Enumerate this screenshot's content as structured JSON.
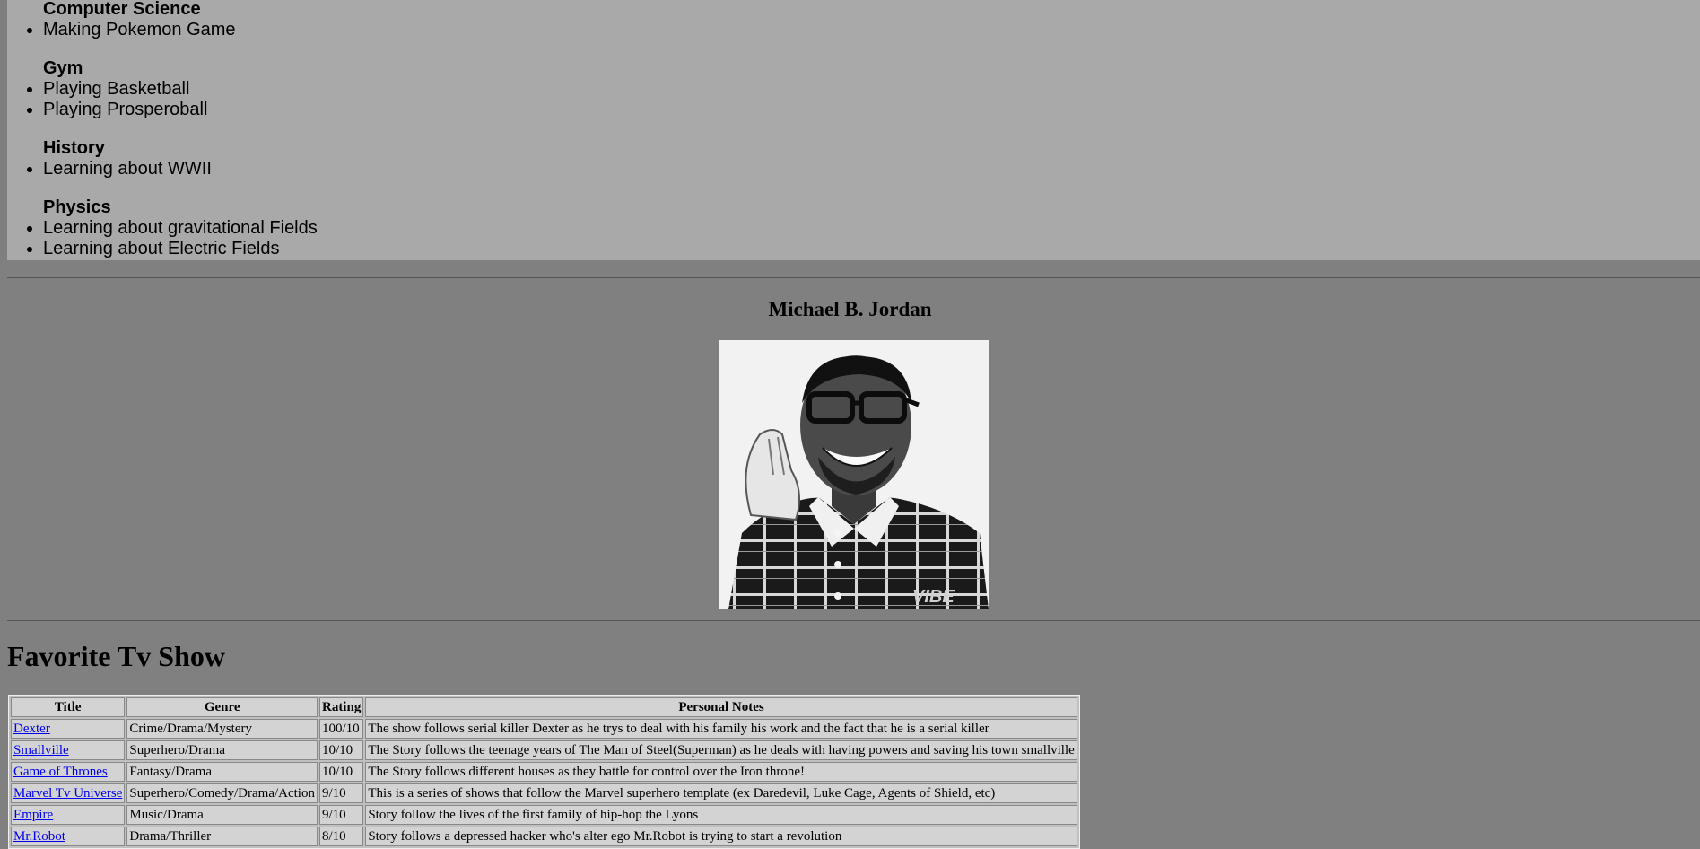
{
  "classes": [
    {
      "subject": "Computer Science",
      "items": [
        "Making Pokemon Game"
      ]
    },
    {
      "subject": "Gym",
      "items": [
        "Playing Basketball",
        "Playing Prosperoball"
      ]
    },
    {
      "subject": "History",
      "items": [
        "Learning about WWII"
      ]
    },
    {
      "subject": "Physics",
      "items": [
        "Learning about gravitational Fields",
        "Learning about Electric Fields"
      ]
    }
  ],
  "celebrity": {
    "name": "Michael B. Jordan",
    "photo_watermark": "VIBE"
  },
  "tv_section": {
    "heading": "Favorite Tv Show",
    "columns": [
      "Title",
      "Genre",
      "Rating",
      "Personal Notes"
    ],
    "rows": [
      {
        "title": "Dexter",
        "genre": "Crime/Drama/Mystery",
        "rating": "100/10",
        "notes": "The show follows serial killer Dexter as he trys to deal with his family his work and the fact that he is a serial killer"
      },
      {
        "title": "Smallville",
        "genre": "Superhero/Drama",
        "rating": "10/10",
        "notes": "The Story follows the teenage years of The Man of Steel(Superman) as he deals with having powers and saving his town smallville"
      },
      {
        "title": "Game of Thrones",
        "genre": "Fantasy/Drama",
        "rating": "10/10",
        "notes": "The Story follows different houses as they battle for control over the Iron throne!"
      },
      {
        "title": "Marvel Tv Universe",
        "genre": "Superhero/Comedy/Drama/Action",
        "rating": "9/10",
        "notes": "This is a series of shows that follow the Marvel superhero template (ex Daredevil, Luke Cage, Agents of Shield, etc)"
      },
      {
        "title": "Empire",
        "genre": "Music/Drama",
        "rating": "9/10",
        "notes": "Story follow the lives of the first family of hip-hop the Lyons"
      },
      {
        "title": "Mr.Robot",
        "genre": "Drama/Thriller",
        "rating": "8/10",
        "notes": "Story follows a depressed hacker who's alter ego Mr.Robot is trying to start a revolution"
      }
    ]
  },
  "colors": {
    "classes_bg": "#a9a9a9",
    "page_bg": "#808080",
    "link": "#0000ee",
    "table_cell_bg": "#d3d3d3"
  }
}
